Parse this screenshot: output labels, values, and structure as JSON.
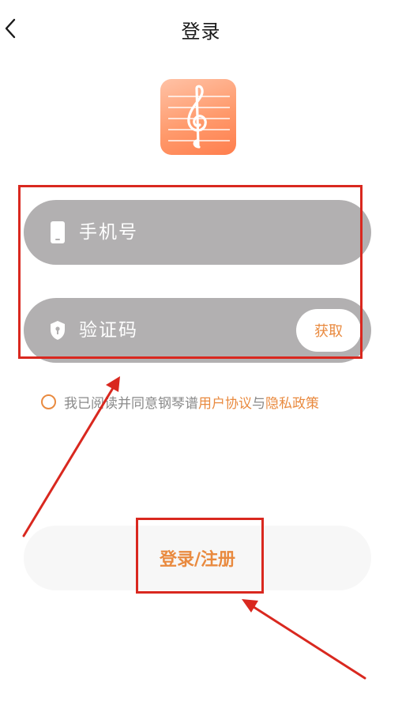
{
  "header": {
    "back_icon": "chevron-left-icon",
    "title": "登录"
  },
  "logo": {
    "icon": "treble-clef-icon"
  },
  "phone_field": {
    "icon": "phone-icon",
    "placeholder": "手机号",
    "value": ""
  },
  "code_field": {
    "icon": "shield-lock-icon",
    "placeholder": "验证码",
    "value": "",
    "get_code_label": "获取"
  },
  "agreement": {
    "prefix": "我已阅读并同意钢琴谱",
    "user_agreement": "用户协议",
    "joiner": "与",
    "privacy_policy": "隐私政策",
    "checked": false
  },
  "login_button": {
    "label": "登录/注册"
  },
  "colors": {
    "accent": "#e98a3f",
    "field_bg": "#b2b0b1",
    "annotation": "#d9281f"
  }
}
